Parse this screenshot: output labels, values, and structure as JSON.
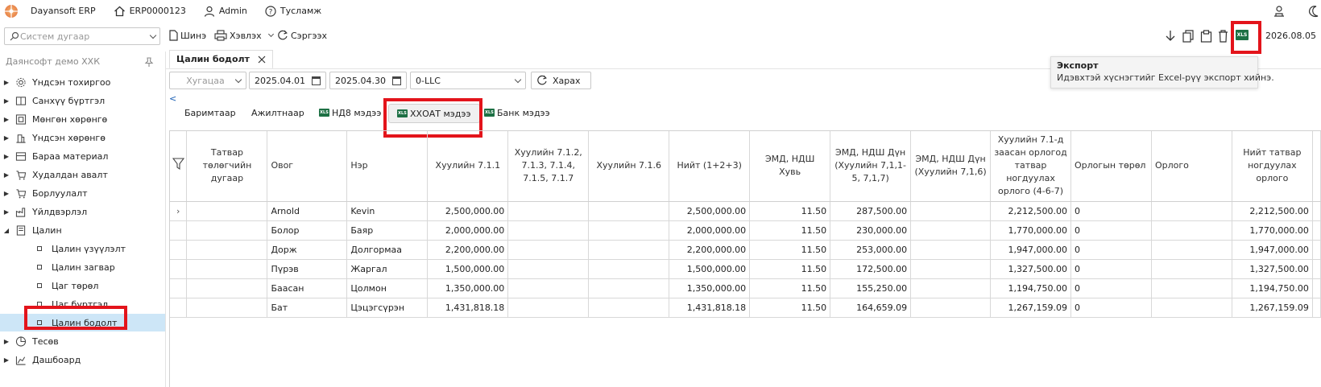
{
  "topbar": {
    "app_name": "Dayansoft ERP",
    "company_code": "ERP0000123",
    "user": "Admin",
    "help": "Тусламж"
  },
  "toolbar": {
    "search_placeholder": "Систем дугаар",
    "new_label": "Шинэ",
    "print_label": "Хэвлэх",
    "refresh_label": "Сэргээх",
    "date": "2026.08.05"
  },
  "sidebar": {
    "company": "Даянсофт демо ХХК",
    "items": [
      {
        "label": "Үндсэн тохиргоо",
        "icon": "gear-icon"
      },
      {
        "label": "Санхүү бүртгэл",
        "icon": "ledger-icon"
      },
      {
        "label": "Мөнгөн хөрөнгө",
        "icon": "cash-icon"
      },
      {
        "label": "Үндсэн хөрөнгө",
        "icon": "building-icon"
      },
      {
        "label": "Бараа материал",
        "icon": "inventory-icon"
      },
      {
        "label": "Худалдан авалт",
        "icon": "cart-icon"
      },
      {
        "label": "Борлуулалт",
        "icon": "sales-cart-icon"
      },
      {
        "label": "Үйлдвэрлэл",
        "icon": "factory-icon"
      },
      {
        "label": "Цалин",
        "icon": "payroll-icon"
      }
    ],
    "payroll_children": [
      "Цалин үзүүлэлт",
      "Цалин загвар",
      "Цаг төрөл",
      "Цаг бүртгэл",
      "Цалин бодолт"
    ],
    "bottom_items": [
      {
        "label": "Тесөв",
        "icon": "pie-chart-icon"
      },
      {
        "label": "Дашбоард",
        "icon": "dashboard-icon"
      }
    ]
  },
  "tab": {
    "label": "Цалин бодолт"
  },
  "filters": {
    "period_placeholder": "Хугацаа",
    "date_from": "2025.04.01",
    "date_to": "2025.04.30",
    "company": "0-LLC",
    "view_label": "Харах"
  },
  "subtabs": [
    "Баримтаар",
    "Ажилтнаар",
    "НД8 мэдээ",
    "ХХОАТ мэдээ",
    "Банк мэдээ"
  ],
  "tooltip": {
    "title": "Экспорт",
    "desc": "Идэвхтэй хүснэгтийг Excel-рүү экспорт хийнэ."
  },
  "table": {
    "headers": [
      "Татвар төлөгчийн дугаар",
      "Овог",
      "Нэр",
      "Хуулийн 7.1.1",
      "Хуулийн 7.1.2, 7.1.3, 7.1.4, 7.1.5, 7.1.7",
      "Хуулийн 7.1.6",
      "Нийт (1+2+3)",
      "ЭМД, НДШ Хувь",
      "ЭМД, НДШ Дүн (Хуулийн 7,1,1-5, 7,1,7)",
      "ЭМД, НДШ Дүн (Хуулийн 7,1,6)",
      "Хуулийн 7.1-д заасан орлогод татвар ногдуулах орлого (4-6-7)",
      "Орлогын төрөл",
      "Орлого",
      "Нийт татвар ногдуулах орлого"
    ],
    "rows": [
      [
        "",
        "Arnold",
        "Kevin",
        "2,500,000.00",
        "",
        "",
        "2,500,000.00",
        "11.50",
        "287,500.00",
        "",
        "2,212,500.00",
        "0",
        "",
        "2,212,500.00"
      ],
      [
        "",
        "Болор",
        "Баяр",
        "2,000,000.00",
        "",
        "",
        "2,000,000.00",
        "11.50",
        "230,000.00",
        "",
        "1,770,000.00",
        "0",
        "",
        "1,770,000.00"
      ],
      [
        "",
        "Дорж",
        "Долгормаа",
        "2,200,000.00",
        "",
        "",
        "2,200,000.00",
        "11.50",
        "253,000.00",
        "",
        "1,947,000.00",
        "0",
        "",
        "1,947,000.00"
      ],
      [
        "",
        "Пүрэв",
        "Жаргал",
        "1,500,000.00",
        "",
        "",
        "1,500,000.00",
        "11.50",
        "172,500.00",
        "",
        "1,327,500.00",
        "0",
        "",
        "1,327,500.00"
      ],
      [
        "",
        "Баасан",
        "Цолмон",
        "1,350,000.00",
        "",
        "",
        "1,350,000.00",
        "11.50",
        "155,250.00",
        "",
        "1,194,750.00",
        "0",
        "",
        "1,194,750.00"
      ],
      [
        "",
        "Бат",
        "Цэцэгсүрэн",
        "1,431,818.18",
        "",
        "",
        "1,431,818.18",
        "11.50",
        "164,659.09",
        "",
        "1,267,159.09",
        "0",
        "",
        "1,267,159.09"
      ]
    ]
  },
  "colors": {
    "highlight": "#e3141b",
    "selected": "#cde6f7",
    "excel_green": "#1d7044"
  }
}
